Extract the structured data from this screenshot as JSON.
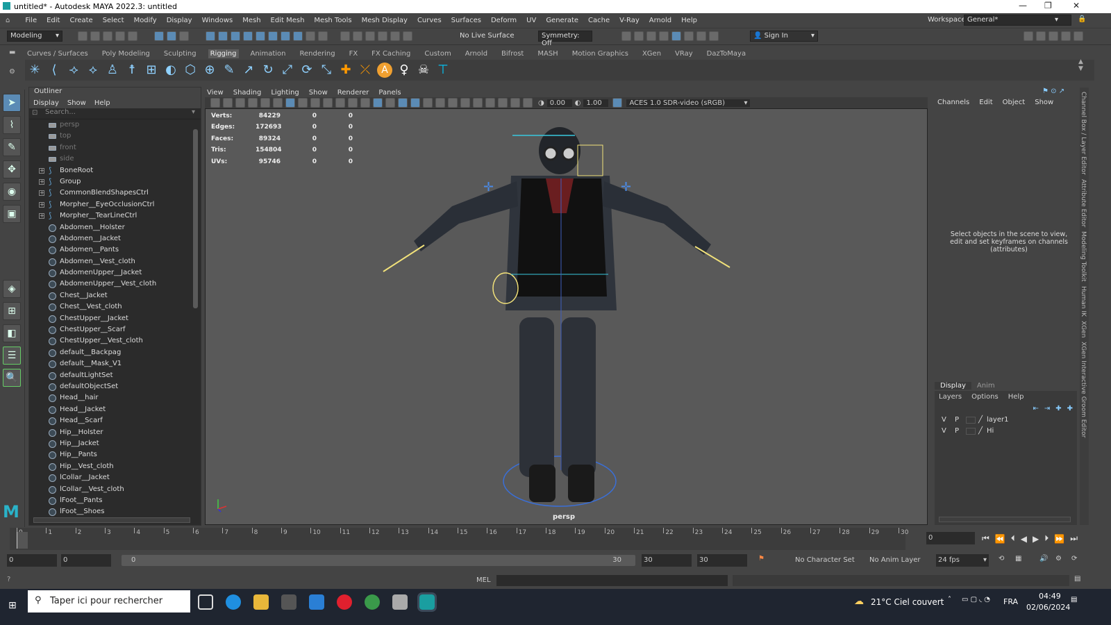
{
  "window": {
    "title": "untitled* - Autodesk MAYA 2022.3: untitled"
  },
  "menubar": [
    "File",
    "Edit",
    "Create",
    "Select",
    "Modify",
    "Display",
    "Windows",
    "Mesh",
    "Edit Mesh",
    "Mesh Tools",
    "Mesh Display",
    "Curves",
    "Surfaces",
    "Deform",
    "UV",
    "Generate",
    "Cache",
    "V-Ray",
    "Arnold",
    "Help"
  ],
  "workspace": {
    "label": "Workspace:",
    "value": "General*"
  },
  "toolbar": {
    "mode": "Modeling",
    "live_surface": "No Live Surface",
    "symmetry": "Symmetry: Off",
    "sign_in": "Sign In"
  },
  "shelf_tabs": [
    "Curves / Surfaces",
    "Poly Modeling",
    "Sculpting",
    "Rigging",
    "Animation",
    "Rendering",
    "FX",
    "FX Caching",
    "Custom",
    "Arnold",
    "Bifrost",
    "MASH",
    "Motion Graphics",
    "XGen",
    "VRay",
    "DazToMaya"
  ],
  "shelf_active": "Rigging",
  "outliner": {
    "title": "Outliner",
    "menu": [
      "Display",
      "Show",
      "Help"
    ],
    "search_placeholder": "Search...",
    "items": [
      {
        "label": "persp",
        "type": "cam",
        "dim": true
      },
      {
        "label": "top",
        "type": "cam",
        "dim": true
      },
      {
        "label": "front",
        "type": "cam",
        "dim": true
      },
      {
        "label": "side",
        "type": "cam",
        "dim": true
      },
      {
        "label": "BoneRoot",
        "type": "jnt",
        "expand": true
      },
      {
        "label": "Group",
        "type": "jnt",
        "expand": true
      },
      {
        "label": "CommonBlendShapesCtrl",
        "type": "jnt",
        "expand": true
      },
      {
        "label": "Morpher__EyeOcclusionCtrl",
        "type": "jnt",
        "expand": true
      },
      {
        "label": "Morpher__TearLineCtrl",
        "type": "jnt",
        "expand": true
      },
      {
        "label": "Abdomen__Holster",
        "type": "set"
      },
      {
        "label": "Abdomen__Jacket",
        "type": "set"
      },
      {
        "label": "Abdomen__Pants",
        "type": "set"
      },
      {
        "label": "Abdomen__Vest_cloth",
        "type": "set"
      },
      {
        "label": "AbdomenUpper__Jacket",
        "type": "set"
      },
      {
        "label": "AbdomenUpper__Vest_cloth",
        "type": "set"
      },
      {
        "label": "Chest__Jacket",
        "type": "set"
      },
      {
        "label": "Chest__Vest_cloth",
        "type": "set"
      },
      {
        "label": "ChestUpper__Jacket",
        "type": "set"
      },
      {
        "label": "ChestUpper__Scarf",
        "type": "set"
      },
      {
        "label": "ChestUpper__Vest_cloth",
        "type": "set"
      },
      {
        "label": "default__Backpag",
        "type": "set"
      },
      {
        "label": "default__Mask_V1",
        "type": "set"
      },
      {
        "label": "defaultLightSet",
        "type": "set"
      },
      {
        "label": "defaultObjectSet",
        "type": "set"
      },
      {
        "label": "Head__hair",
        "type": "set"
      },
      {
        "label": "Head__Jacket",
        "type": "set"
      },
      {
        "label": "Head__Scarf",
        "type": "set"
      },
      {
        "label": "Hip__Holster",
        "type": "set"
      },
      {
        "label": "Hip__Jacket",
        "type": "set"
      },
      {
        "label": "Hip__Pants",
        "type": "set"
      },
      {
        "label": "Hip__Vest_cloth",
        "type": "set"
      },
      {
        "label": "lCollar__Jacket",
        "type": "set"
      },
      {
        "label": "lCollar__Vest_cloth",
        "type": "set"
      },
      {
        "label": "lFoot__Pants",
        "type": "set"
      },
      {
        "label": "lFoot__Shoes",
        "type": "set"
      }
    ]
  },
  "viewport": {
    "menu": [
      "View",
      "Shading",
      "Lighting",
      "Show",
      "Renderer",
      "Panels"
    ],
    "exposure": "0.00",
    "gamma": "1.00",
    "color_space": "ACES 1.0 SDR-video (sRGB)",
    "camera": "persp",
    "hud": [
      {
        "k": "Verts:",
        "v": "84229",
        "a": "0",
        "b": "0"
      },
      {
        "k": "Edges:",
        "v": "172693",
        "a": "0",
        "b": "0"
      },
      {
        "k": "Faces:",
        "v": "89324",
        "a": "0",
        "b": "0"
      },
      {
        "k": "Tris:",
        "v": "154804",
        "a": "0",
        "b": "0"
      },
      {
        "k": "UVs:",
        "v": "95746",
        "a": "0",
        "b": "0"
      }
    ]
  },
  "channelbox": {
    "menu": [
      "Channels",
      "Edit",
      "Object",
      "Show"
    ],
    "message": "Select objects in the scene to view, edit and set keyframes on channels (attributes)",
    "tabs": [
      "Display",
      "Anim"
    ],
    "layer_menu": [
      "Layers",
      "Options",
      "Help"
    ],
    "layers": [
      {
        "v": "V",
        "p": "P",
        "name": "layer1"
      },
      {
        "v": "V",
        "p": "P",
        "name": "Hi"
      }
    ]
  },
  "sidebar_tabs": [
    "Channel Box / Layer Editor",
    "Attribute Editor",
    "Modeling Toolkit",
    "Human IK",
    "XGen",
    "XGen Interactive Groom Editor"
  ],
  "timeline": {
    "ticks": [
      "0",
      "1",
      "2",
      "3",
      "4",
      "5",
      "6",
      "7",
      "8",
      "9",
      "10",
      "11",
      "12",
      "13",
      "14",
      "15",
      "16",
      "17",
      "18",
      "19",
      "20",
      "21",
      "22",
      "23",
      "24",
      "25",
      "26",
      "27",
      "28",
      "29",
      "30"
    ],
    "current": "0"
  },
  "range": {
    "start": "0",
    "start2": "0",
    "slider_start": "0",
    "slider_end": "30",
    "end": "30",
    "end2": "30",
    "character_set": "No Character Set",
    "anim_layer": "No Anim Layer",
    "fps": "24 fps"
  },
  "cmd": {
    "lang": "MEL"
  },
  "taskbar": {
    "search": "Taper ici pour rechercher",
    "weather": "21°C  Ciel couvert",
    "lang": "FRA",
    "time": "04:49",
    "date": "02/06/2024"
  }
}
